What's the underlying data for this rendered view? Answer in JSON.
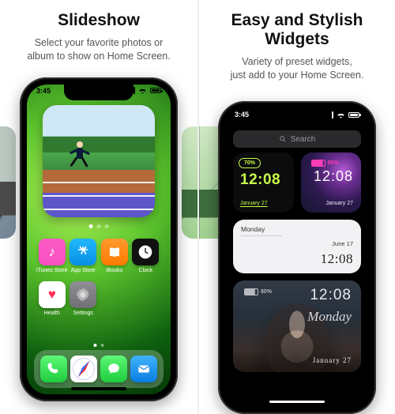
{
  "left": {
    "title": "Slideshow",
    "subtitle_l1": "Select your favorite photos or",
    "subtitle_l2": "album to show on Home Screen.",
    "status_time": "3:45",
    "apps": {
      "music": "iTunes Store",
      "store": "App Store",
      "books": "iBooks",
      "clock": "Clock",
      "health": "Health",
      "gear": "Settings"
    }
  },
  "right": {
    "title_l1": "Easy and Stylish",
    "title_l2": "Widgets",
    "subtitle_l1": "Variety of preset widgets,",
    "subtitle_l2": "just add to your Home Screen.",
    "status_time": "3:45",
    "search_placeholder": "Search",
    "widgets": {
      "lime": {
        "battery": "70%",
        "time": "12:08",
        "date": "January 27"
      },
      "galaxy": {
        "battery": "85%",
        "time": "12:08",
        "date": "January 27"
      },
      "marble": {
        "day": "Monday",
        "date": "June 17",
        "time": "12:08"
      },
      "face": {
        "battery": "80%",
        "time": "12:08",
        "day": "Monday",
        "date": "January 27"
      }
    }
  }
}
